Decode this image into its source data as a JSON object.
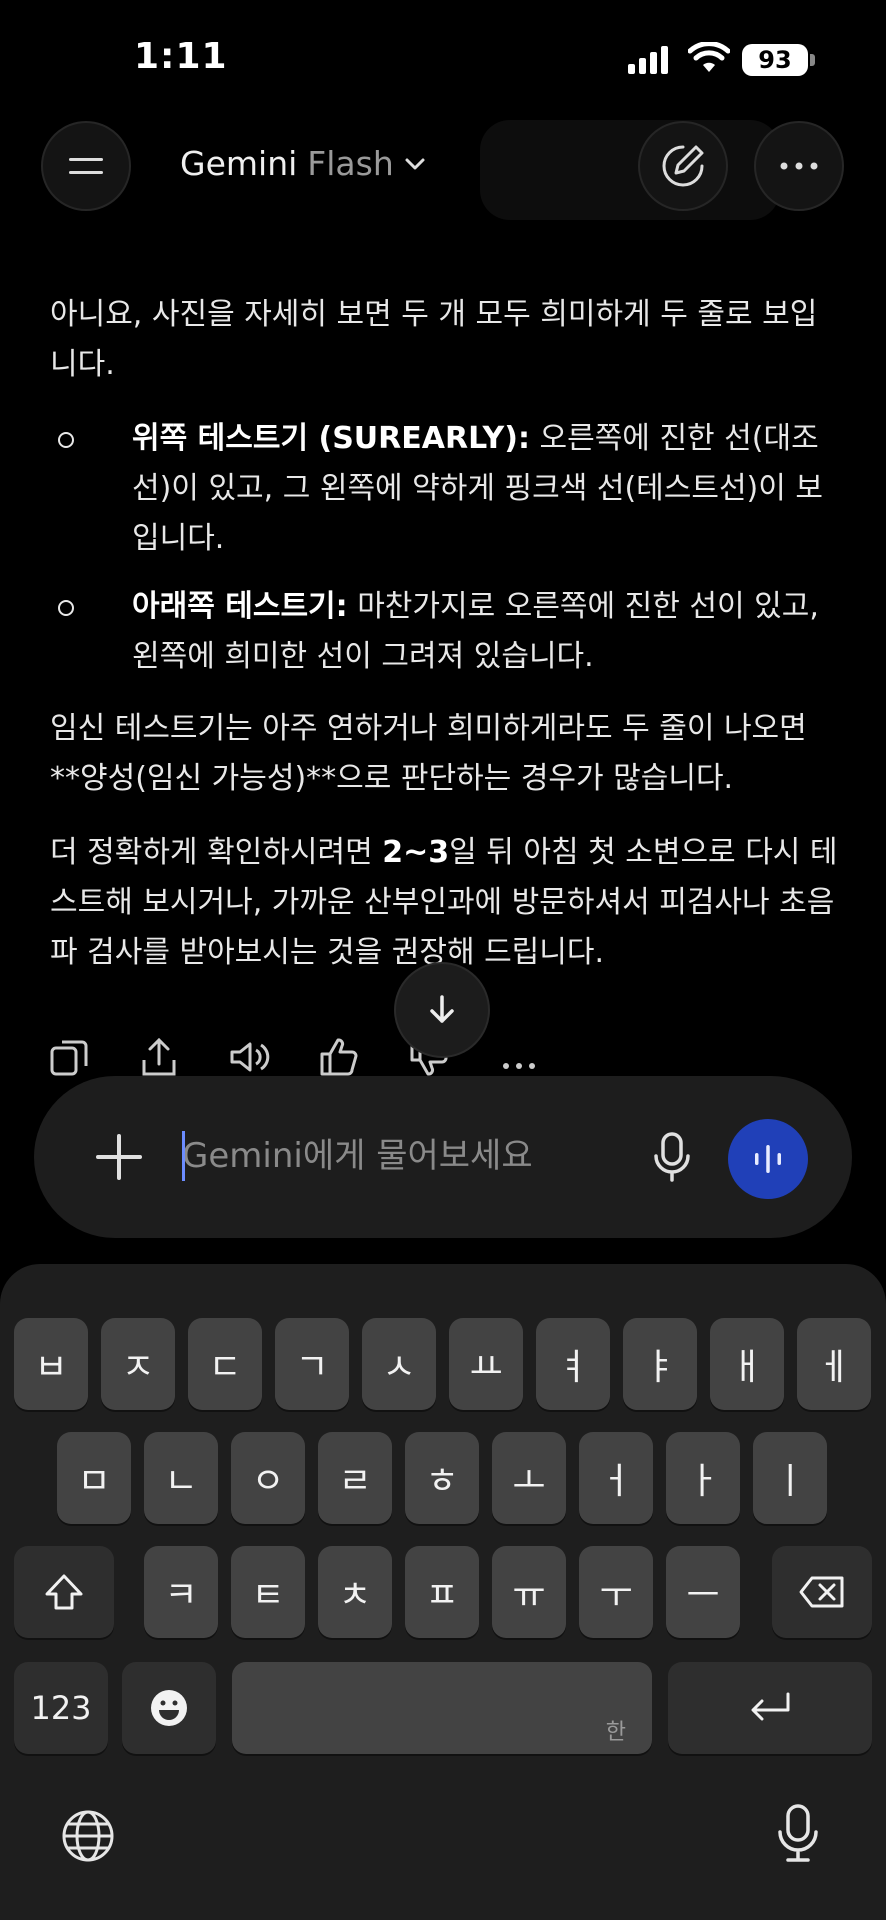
{
  "status": {
    "time": "1:11",
    "battery": "93"
  },
  "header": {
    "model_name": "Gemini",
    "model_variant": "Flash"
  },
  "message": {
    "intro": "아니요, 사진을 자세히 보면 두 개 모두 희미하게 두 줄로 보입니다.",
    "bullets": [
      {
        "label": "위쪽 테스트기 (SUREARLY):",
        "text": " 오른쪽에 진한 선(대조선)이 있고, 그 왼쪽에 약하게 핑크색 선(테스트선)이 보입니다."
      },
      {
        "label": "아래쪽 테스트기:",
        "text": " 마찬가지로 오른쪽에 진한 선이 있고, 왼쪽에 희미한 선이 그려져 있습니다."
      }
    ],
    "para2": "임신 테스트기는 아주 연하거나 희미하게라도 두 줄이 나오면 **양성(임신 가능성)**으로 판단하는 경우가 많습니다.",
    "para3_a": "더 정확하게 확인하시려면 ",
    "para3_bold": "2~3",
    "para3_b": "일 뒤 아침 첫 소변으로 다시 테스트해 보시거나, 가까운 산부인과에 방문하셔서 피검사나 초음파 검사를 받아보시는 것을 권장해 드립니다."
  },
  "input": {
    "placeholder": "Gemini에게 물어보세요"
  },
  "keyboard": {
    "row1": [
      "ㅂ",
      "ㅈ",
      "ㄷ",
      "ㄱ",
      "ㅅ",
      "ㅛ",
      "ㅕ",
      "ㅑ",
      "ㅐ",
      "ㅔ"
    ],
    "row2": [
      "ㅁ",
      "ㄴ",
      "ㅇ",
      "ㄹ",
      "ㅎ",
      "ㅗ",
      "ㅓ",
      "ㅏ",
      "ㅣ"
    ],
    "row3": [
      "ㅋ",
      "ㅌ",
      "ㅊ",
      "ㅍ",
      "ㅠ",
      "ㅜ",
      "ㅡ"
    ],
    "numbers_label": "123",
    "space_hint": "한"
  },
  "icons": {
    "menu": "menu-icon",
    "edit": "new-chat-icon",
    "more": "more-icon",
    "copy": "copy-icon",
    "share": "share-icon",
    "listen": "speaker-icon",
    "like": "thumbs-up-icon",
    "dislike": "thumbs-down-icon",
    "plus": "plus-icon",
    "mic": "mic-icon",
    "live": "live-icon",
    "shift": "shift-icon",
    "backspace": "backspace-icon",
    "emoji": "emoji-icon",
    "return": "return-icon",
    "globe": "globe-icon",
    "dictation": "dictation-icon"
  },
  "colors": {
    "accent": "#2040b8",
    "background": "#000000",
    "key": "#434343"
  }
}
